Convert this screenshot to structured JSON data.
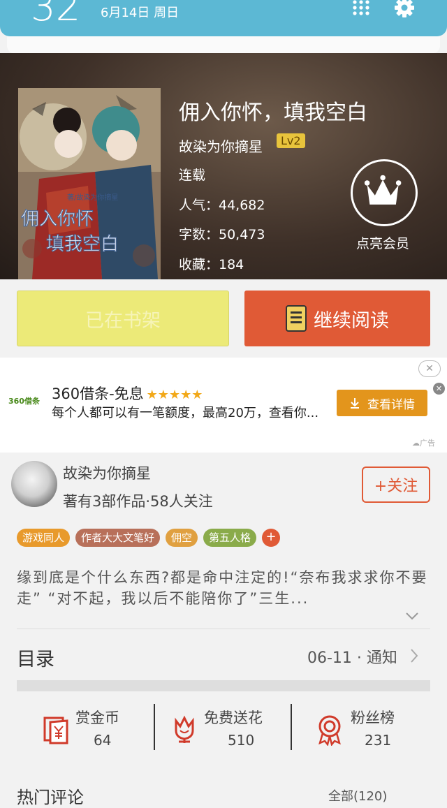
{
  "status_bar": {
    "time": "32",
    "date": "6月14日 周日"
  },
  "book": {
    "title": "佣入你怀，填我空白",
    "author": "故染为你摘星",
    "level": "Lv2",
    "status": "连载",
    "popularity": "人气：44,682",
    "word_count": "字数：50,473",
    "favorites": "收藏：184",
    "cover_text_line1": "佣入你怀",
    "cover_text_line2": "填我空白",
    "cover_subtext": "著/故染为你摘星"
  },
  "vip": {
    "label": "点亮会员"
  },
  "actions": {
    "shelf_label": "已在书架",
    "read_label": "继续阅读"
  },
  "ad": {
    "logo_text": "360借条",
    "title": "360借条-免息",
    "stars": "★★★★★",
    "description": "每个人都可以有一笔额度，最高20万，查看你...",
    "button_label": "查看详情",
    "close_top": "✕",
    "close_side": "✕",
    "marker": "☁广告"
  },
  "author_section": {
    "name": "故染为你摘星",
    "stats": "著有3部作品·58人关注",
    "follow_label": "+关注"
  },
  "tags": [
    {
      "label": "游戏同人",
      "color": "#e89a2c"
    },
    {
      "label": "作者大大文笔好",
      "color": "#b8705a"
    },
    {
      "label": "佣空",
      "color": "#e0a040"
    },
    {
      "label": "第五人格",
      "color": "#8aab4a"
    }
  ],
  "tag_add": "+",
  "synopsis": "缘到底是个什么东西?都是命中注定的!“奈布我求求你不要走”  “对不起，我以后不能陪你了”三生...",
  "toc": {
    "label": "目录",
    "latest": "06-11 · 通知"
  },
  "stats": [
    {
      "label": "赏金币",
      "value": "64",
      "icon": "reward-coin-icon"
    },
    {
      "label": "免费送花",
      "value": "510",
      "icon": "flower-icon"
    },
    {
      "label": "粉丝榜",
      "value": "231",
      "icon": "fan-badge-icon"
    }
  ],
  "comments": {
    "header": "热门评论",
    "more": "全部(120)"
  }
}
